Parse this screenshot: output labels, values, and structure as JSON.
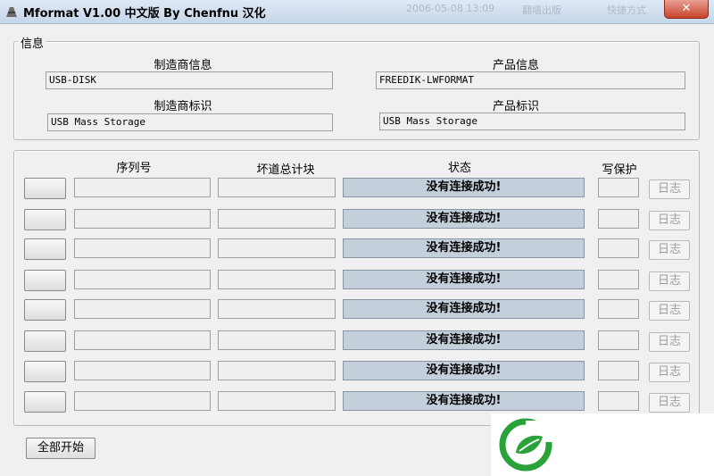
{
  "window": {
    "title": "Mformat V1.00 中文版 By Chenfnu 汉化",
    "close_label": "✕"
  },
  "background_window": {
    "text_1": "2006-05-08 13:09",
    "text_2": "翻墙出版",
    "text_3": "快捷方式"
  },
  "info_group": {
    "legend": "信息",
    "manufacturer_label": "制造商信息",
    "manufacturer_value": "USB-DISK",
    "product_label": "产品信息",
    "product_value": "FREEDIK-LWFORMAT",
    "manufacturer_id_label": "制造商标识",
    "manufacturer_id_value": "USB Mass Storage",
    "product_id_label": "产品标识",
    "product_id_value": "USB Mass Storage"
  },
  "devices": {
    "headers": {
      "serial": "序列号",
      "bad_blocks": "坏道总计块",
      "status": "状态",
      "write_protect": "写保护"
    },
    "rows": [
      {
        "status": "没有连接成功!",
        "log": "日志"
      },
      {
        "status": "没有连接成功!",
        "log": "日志"
      },
      {
        "status": "没有连接成功!",
        "log": "日志"
      },
      {
        "status": "没有连接成功!",
        "log": "日志"
      },
      {
        "status": "没有连接成功!",
        "log": "日志"
      },
      {
        "status": "没有连接成功!",
        "log": "日志"
      },
      {
        "status": "没有连接成功!",
        "log": "日志"
      },
      {
        "status": "没有连接成功!",
        "log": "日志"
      }
    ]
  },
  "start_all_label": "全部开始",
  "colors": {
    "status_fill": "#c4cfdc",
    "logo_green": "#2aa23a"
  }
}
